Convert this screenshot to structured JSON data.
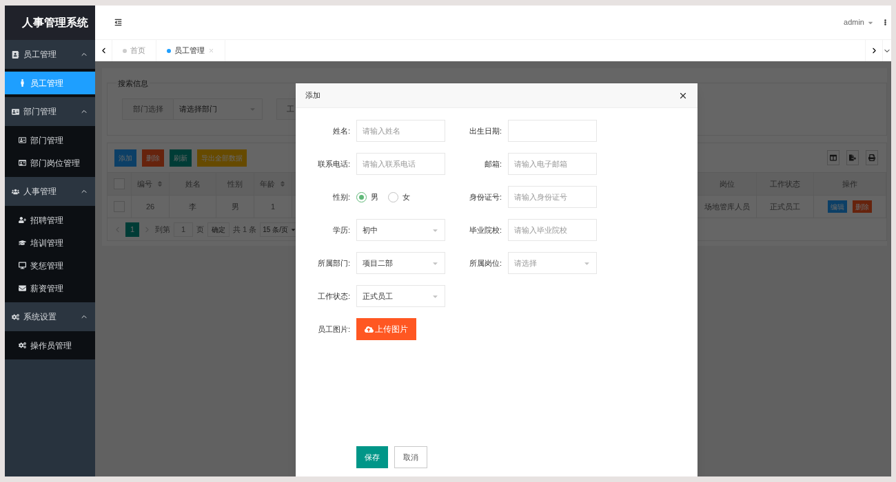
{
  "app_title": "人事管理系统",
  "sidebar": {
    "groups": [
      {
        "label": "员工管理",
        "expanded": true,
        "items": [
          {
            "label": "员工管理",
            "selected": true
          }
        ]
      },
      {
        "label": "部门管理",
        "expanded": true,
        "items": [
          {
            "label": "部门管理",
            "selected": false
          },
          {
            "label": "部门岗位管理",
            "selected": false
          }
        ]
      },
      {
        "label": "人事管理",
        "expanded": true,
        "items": [
          {
            "label": "招聘管理",
            "selected": false
          },
          {
            "label": "培训管理",
            "selected": false
          },
          {
            "label": "奖惩管理",
            "selected": false
          },
          {
            "label": "薪资管理",
            "selected": false
          }
        ]
      },
      {
        "label": "系统设置",
        "expanded": true,
        "items": [
          {
            "label": "操作员管理",
            "selected": false
          }
        ]
      }
    ]
  },
  "header": {
    "user": "admin"
  },
  "tabs": [
    {
      "label": "首页",
      "selected": false,
      "closable": false
    },
    {
      "label": "员工管理",
      "selected": true,
      "closable": true
    }
  ],
  "search": {
    "legend": "搜索信息",
    "fields": [
      {
        "label": "部门选择",
        "placeholder": "请选择部门"
      },
      {
        "label": "工"
      }
    ]
  },
  "toolbar": [
    {
      "label": "添加",
      "kind": "normal"
    },
    {
      "label": "删除",
      "kind": "danger"
    },
    {
      "label": "刷新",
      "kind": "success"
    },
    {
      "label": "导出全部数据",
      "kind": "warm"
    }
  ],
  "table": {
    "select_all_checked": false,
    "columns": [
      {
        "label": "编号",
        "sortable": true
      },
      {
        "label": "姓名",
        "sortable": false
      },
      {
        "label": "性别",
        "sortable": false
      },
      {
        "label": "年龄",
        "sortable": true
      },
      {
        "label": "岗位",
        "sortable": false
      },
      {
        "label": "工作状态",
        "sortable": false
      },
      {
        "label": "操作",
        "sortable": false
      }
    ],
    "rows": [
      {
        "checked": false,
        "cells": [
          "26",
          "李",
          "男",
          "1",
          "场地管库人员",
          "正式员工"
        ],
        "actions": [
          "编辑",
          "删除"
        ]
      }
    ]
  },
  "pagination": {
    "pages": [
      {
        "label": "1",
        "selected": true
      }
    ],
    "goto_label": "到第",
    "goto_value": "1",
    "page_suffix": "页",
    "confirm": "确定",
    "total": "共 1 条",
    "page_size": "15 条/页"
  },
  "modal": {
    "title": "添加",
    "rows": [
      [
        {
          "kind": "text",
          "label": "姓名:",
          "placeholder": "请输入姓名"
        },
        {
          "kind": "text",
          "label": "出生日期:"
        }
      ],
      [
        {
          "kind": "text",
          "label": "联系电话:",
          "placeholder": "请输入联系电话"
        },
        {
          "kind": "text",
          "label": "邮箱:",
          "placeholder": "请输入电子邮箱"
        }
      ],
      [
        {
          "kind": "radio",
          "label": "性别:",
          "options": [
            {
              "label": "男",
              "selected": true
            },
            {
              "label": "女",
              "selected": false
            }
          ]
        },
        {
          "kind": "text",
          "label": "身份证号:",
          "placeholder": "请输入身份证号"
        }
      ],
      [
        {
          "kind": "select",
          "label": "学历:",
          "value": "初中"
        },
        {
          "kind": "text",
          "label": "毕业院校:",
          "placeholder": "请输入毕业院校"
        }
      ],
      [
        {
          "kind": "select",
          "label": "所属部门:",
          "value": "项目二部"
        },
        {
          "kind": "select",
          "label": "所属岗位:",
          "placeholder": "请选择"
        }
      ],
      [
        {
          "kind": "select",
          "label": "工作状态:",
          "value": "正式员工"
        }
      ],
      [
        {
          "kind": "upload",
          "label": "员工图片:",
          "button": "上传图片"
        }
      ]
    ],
    "buttons": [
      {
        "label": "保存",
        "primary": true
      },
      {
        "label": "取消",
        "primary": false
      }
    ]
  }
}
